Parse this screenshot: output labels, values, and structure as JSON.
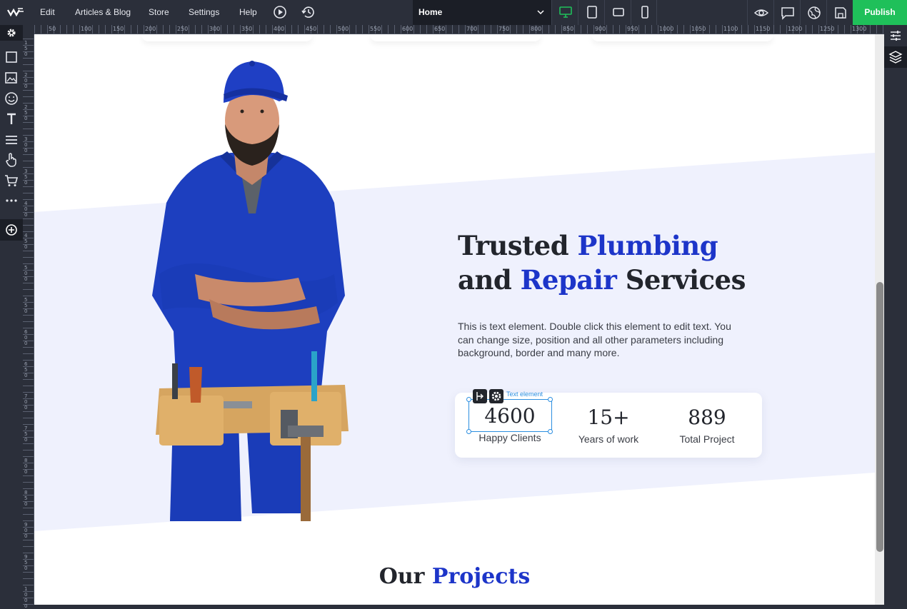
{
  "toolbar": {
    "menu": [
      "Edit",
      "Articles & Blog",
      "Store",
      "Settings",
      "Help"
    ],
    "page_select": "Home",
    "publish_label": "Publish"
  },
  "ruler": {
    "marks": [
      "50",
      "100",
      "150",
      "200",
      "250",
      "300",
      "350",
      "400",
      "450",
      "500",
      "550",
      "600",
      "650",
      "700",
      "750",
      "800",
      "850",
      "900",
      "950",
      "1000",
      "1050",
      "1100",
      "1150",
      "1200",
      "1250",
      "1300"
    ],
    "vmarks": [
      "150",
      "200",
      "250",
      "300",
      "350",
      "400",
      "450",
      "500",
      "550",
      "600",
      "650",
      "700",
      "750",
      "800",
      "850",
      "900",
      "950",
      "1000"
    ]
  },
  "hero": {
    "title_line1_a": "Trusted ",
    "title_line1_b": "Plumbing",
    "title_line2_a": "and ",
    "title_line2_b": "Repair",
    "title_line2_c": " Services",
    "body": "This is text element. Double click this element to edit text. You can change size, position and all other parameters including background, border and many more."
  },
  "stats": [
    {
      "value": "4600",
      "label": "Happy Clients"
    },
    {
      "value": "15+",
      "label": "Years of work"
    },
    {
      "value": "889",
      "label": "Total Project"
    }
  ],
  "selection": {
    "tag": "Text element"
  },
  "projects": {
    "title_a": "Our ",
    "title_b": "Projects"
  },
  "colors": {
    "accent": "#1d35c9",
    "publish": "#1fc05a",
    "band": "#eff1fd",
    "shirt": "#1d3fbf"
  },
  "icons": {
    "top": [
      "logo-icon",
      "play-icon",
      "history-icon",
      "desktop-icon",
      "tablet-icon",
      "tablet-landscape-icon",
      "mobile-icon",
      "eye-icon",
      "comment-icon",
      "globe-icon",
      "save-icon"
    ],
    "left": [
      "gear-icon",
      "square-icon",
      "image-icon",
      "smiley-icon",
      "text-icon",
      "menu-icon",
      "hand-pointer-icon",
      "cart-icon",
      "more-icon",
      "add-circle-icon"
    ],
    "right": [
      "sliders-icon",
      "layers-icon"
    ]
  }
}
